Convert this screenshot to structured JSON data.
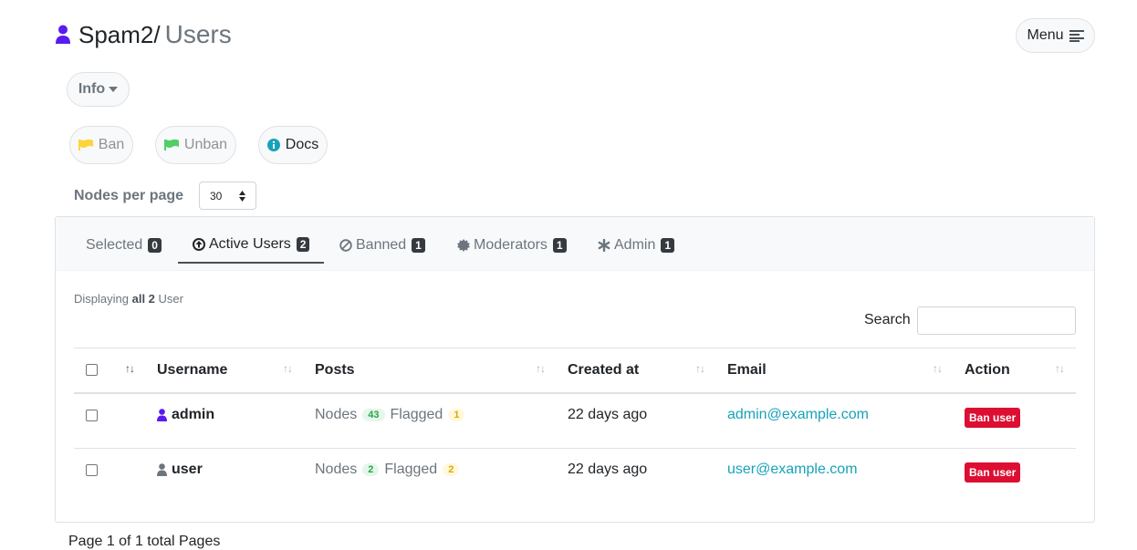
{
  "header": {
    "site": "Spam2/",
    "page": "Users"
  },
  "menu": {
    "label": "Menu"
  },
  "info": {
    "label": "Info"
  },
  "actions": {
    "ban": "Ban",
    "unban": "Unban",
    "docs": "Docs"
  },
  "nodes_per_page": {
    "label": "Nodes per page",
    "value": "30"
  },
  "tabs": [
    {
      "label": "Selected",
      "count": "0"
    },
    {
      "label": "Active Users",
      "count": "2"
    },
    {
      "label": "Banned",
      "count": "1"
    },
    {
      "label": "Moderators",
      "count": "1"
    },
    {
      "label": "Admin",
      "count": "1"
    }
  ],
  "display": {
    "prefix": "Displaying",
    "count": "all 2",
    "suffix": "User"
  },
  "search": {
    "label": "Search",
    "value": ""
  },
  "table": {
    "headers": {
      "username": "Username",
      "posts": "Posts",
      "created": "Created at",
      "email": "Email",
      "action": "Action"
    },
    "rows": [
      {
        "username": "admin",
        "nodes_label": "Nodes",
        "nodes": "43",
        "flagged_label": "Flagged",
        "flagged": "1",
        "created": "22 days ago",
        "email": "admin@example.com",
        "action": "Ban user"
      },
      {
        "username": "user",
        "nodes_label": "Nodes",
        "nodes": "2",
        "flagged_label": "Flagged",
        "flagged": "2",
        "created": "22 days ago",
        "email": "user@example.com",
        "action": "Ban user"
      }
    ]
  },
  "pager": {
    "text": "Page 1 of 1 total Pages"
  },
  "colors": {
    "accent": "#5a1bf0",
    "danger": "#dc0f33",
    "link": "#17a2b8"
  },
  "icons": {
    "user": "user-icon",
    "menu": "menu-lines-icon",
    "flag": "flag-icon",
    "info": "info-circle-icon"
  }
}
